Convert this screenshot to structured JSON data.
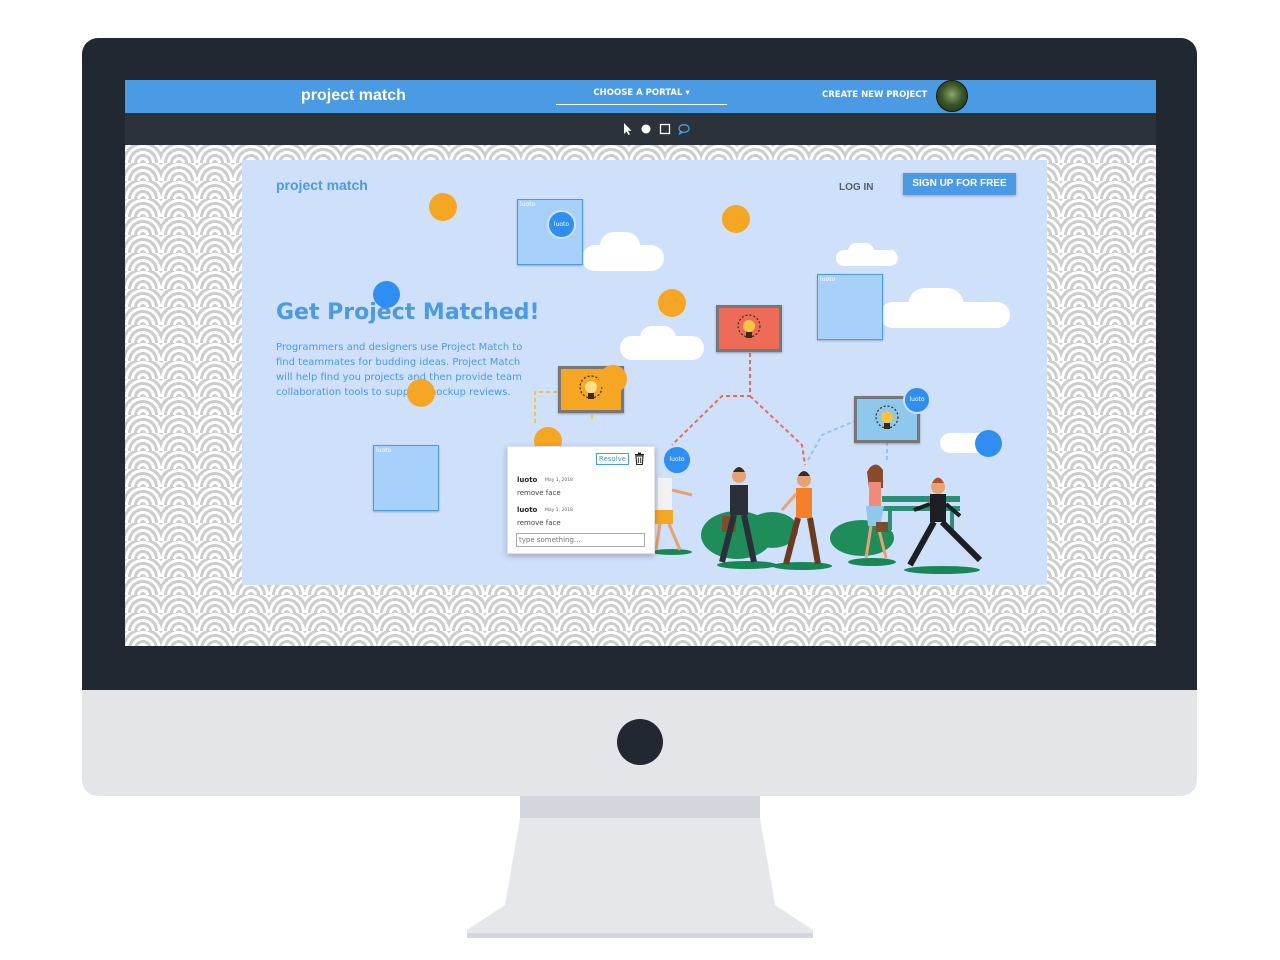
{
  "app": {
    "logo": "project match",
    "portal_label": "CHOOSE A PORTAL ▾",
    "create_label": "CREATE NEW PROJECT"
  },
  "toolbar": {
    "tools": [
      "pointer-tool",
      "circle-tool",
      "square-tool",
      "comment-tool"
    ]
  },
  "landing": {
    "logo": "project match",
    "login": "LOG IN",
    "signup": "SIGN UP FOR FREE",
    "headline": "Get Project Matched!",
    "description": "Programmers and designers use Project Match to find teammates for budding ideas. Project Match will help find you projects and then provide team collaboration tools to support mockup reviews."
  },
  "annotations": {
    "note_label": "luoto",
    "user_marker": "luoto"
  },
  "comment_popup": {
    "resolve": "Resolve",
    "comments": [
      {
        "user": "luoto",
        "date": "May 1, 2018",
        "text": "remove face"
      },
      {
        "user": "luoto",
        "date": "May 1, 2018",
        "text": "remove face"
      }
    ],
    "input_placeholder": "type something..."
  },
  "colors": {
    "brand_blue": "#4a9ae4",
    "toolbar_dark": "#2b323a",
    "annotation_orange": "#f5a623",
    "annotation_blue": "#2e8ff0",
    "ground_green": "#21a36b"
  }
}
